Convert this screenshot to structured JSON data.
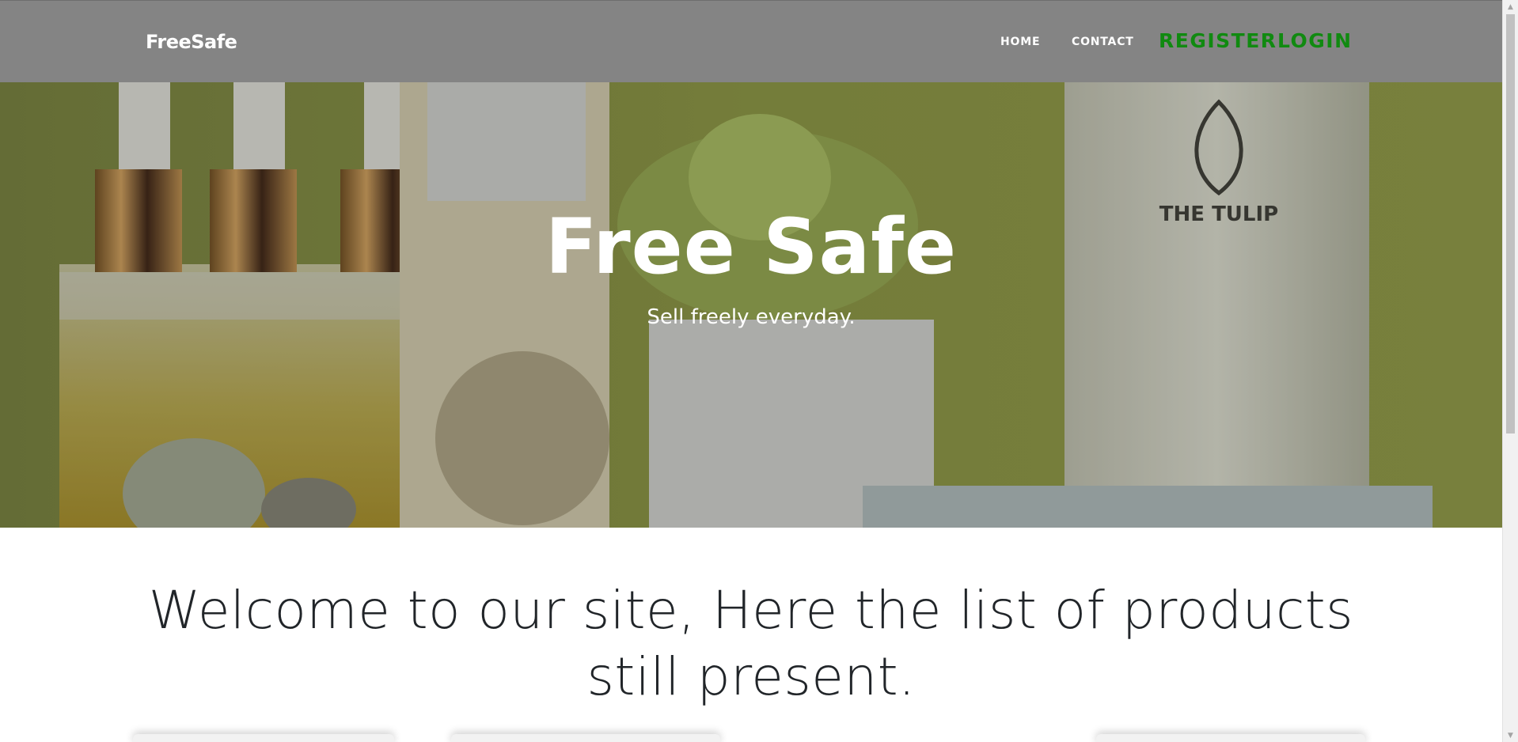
{
  "navbar": {
    "brand": "FreeSafe",
    "links": {
      "home": "HOME",
      "contact": "CONTACT",
      "register": "REGISTER",
      "login": "LOGIN"
    },
    "colors": {
      "background": "#848484",
      "auth_links": "#108a10"
    }
  },
  "hero": {
    "title": "Free Safe",
    "subtitle": "Sell freely everyday.",
    "image_subject": "cosmetic-products-photo"
  },
  "welcome": {
    "heading": "Welcome to our site, Here the list of products still present."
  },
  "scrollbar": {
    "up_icon": "▲",
    "down_icon": "▼"
  }
}
